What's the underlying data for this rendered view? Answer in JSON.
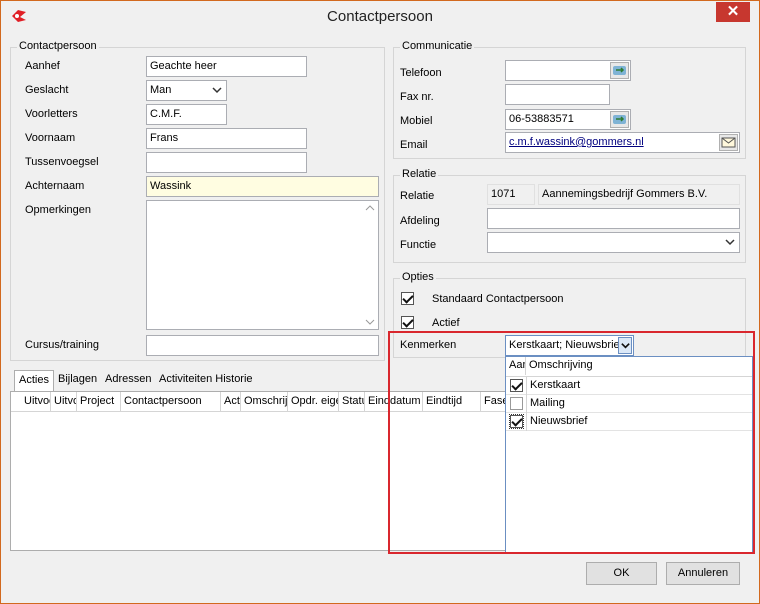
{
  "window": {
    "title": "Contactpersoon",
    "close_label": "✕"
  },
  "contact": {
    "group_title": "Contactpersoon",
    "fields": {
      "aanhef": {
        "label": "Aanhef",
        "value": "Geachte heer"
      },
      "geslacht": {
        "label": "Geslacht",
        "value": "Man"
      },
      "voorletters": {
        "label": "Voorletters",
        "value": "C.M.F."
      },
      "voornaam": {
        "label": "Voornaam",
        "value": "Frans"
      },
      "tussenvoegsel": {
        "label": "Tussenvoegsel",
        "value": ""
      },
      "achternaam": {
        "label": "Achternaam",
        "value": "Wassink"
      },
      "opmerkingen": {
        "label": "Opmerkingen",
        "value": ""
      },
      "cursus": {
        "label": "Cursus/training",
        "value": ""
      }
    }
  },
  "communicatie": {
    "group_title": "Communicatie",
    "telefoon": {
      "label": "Telefoon",
      "value": ""
    },
    "fax": {
      "label": "Fax nr.",
      "value": ""
    },
    "mobiel": {
      "label": "Mobiel",
      "value": "06-53883571"
    },
    "email": {
      "label": "Email",
      "value": "c.m.f.wassink@gommers.nl"
    }
  },
  "relatie": {
    "group_title": "Relatie",
    "relatie": {
      "label": "Relatie",
      "code": "1071",
      "name": "Aannemingsbedrijf Gommers B.V."
    },
    "afdeling": {
      "label": "Afdeling",
      "value": ""
    },
    "functie": {
      "label": "Functie",
      "value": ""
    }
  },
  "opties": {
    "group_title": "Opties",
    "standaard": {
      "label": "Standaard Contactpersoon",
      "checked": true
    },
    "actief": {
      "label": "Actief",
      "checked": true
    },
    "kenmerken": {
      "label": "Kenmerken",
      "value": "Kerstkaart; Nieuwsbrief"
    }
  },
  "kenmerken_dropdown": {
    "col_check": "Aan",
    "col_desc": "Omschrijving",
    "items": [
      {
        "label": "Kerstkaart",
        "checked": true
      },
      {
        "label": "Mailing",
        "checked": false
      },
      {
        "label": "Nieuwsbrief",
        "checked": true
      }
    ]
  },
  "tabs": [
    "Acties",
    "Bijlagen",
    "Adressen",
    "Activiteiten Historie"
  ],
  "grid_columns": [
    "Uitvoe",
    "Uitvo",
    "Project",
    "Contactpersoon",
    "Acti",
    "Omschrijving",
    "Opdr. eigenaar",
    "Status",
    "Einddatum",
    "Eindtijd",
    "Fase"
  ],
  "buttons": {
    "ok": "OK",
    "cancel": "Annuleren"
  },
  "colors": {
    "highlight": "#d9272e",
    "required_bg": "#fffde1",
    "email_link": "#00007f"
  }
}
